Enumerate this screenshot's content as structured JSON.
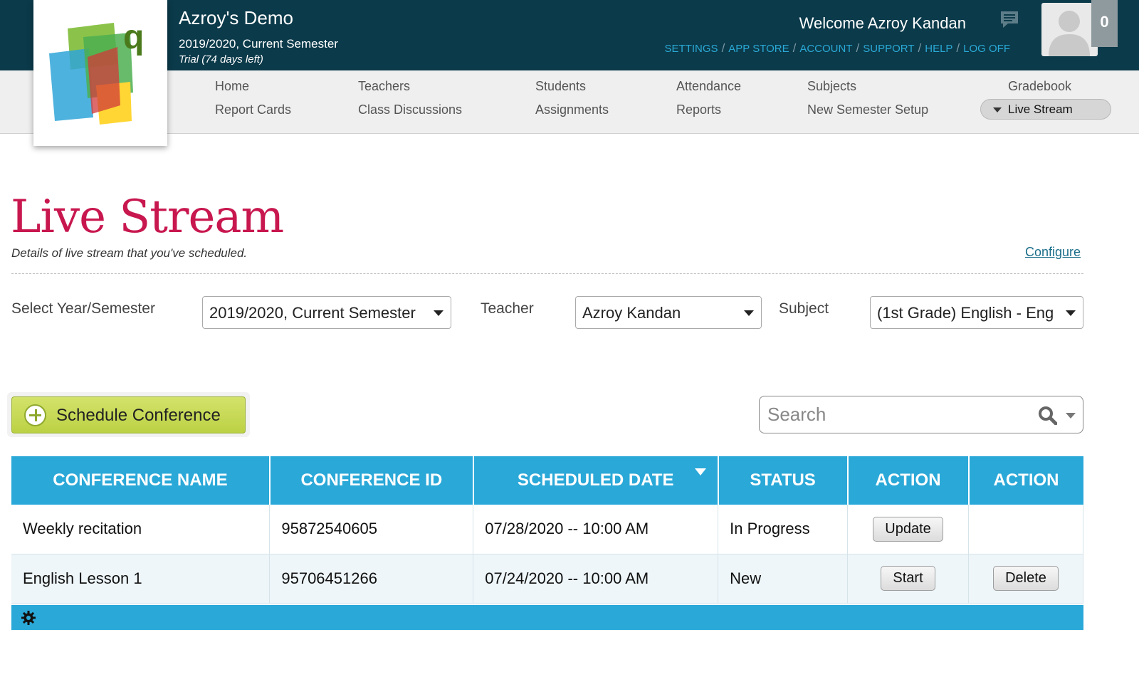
{
  "header": {
    "school_name": "Azroy's Demo",
    "semester": "2019/2020, Current Semester",
    "trial": "Trial (74 days left)",
    "welcome": "Welcome Azroy Kandan",
    "notification_count": "0",
    "links": [
      "SETTINGS",
      "APP STORE",
      "ACCOUNT",
      "SUPPORT",
      "HELP",
      "LOG OFF"
    ]
  },
  "nav": {
    "home": "Home",
    "report_cards": "Report Cards",
    "teachers": "Teachers",
    "class_discussions": "Class Discussions",
    "students": "Students",
    "assignments": "Assignments",
    "attendance": "Attendance",
    "reports": "Reports",
    "subjects": "Subjects",
    "new_semester_setup": "New Semester Setup",
    "gradebook": "Gradebook",
    "live_stream": "Live Stream"
  },
  "page": {
    "title": "Live Stream",
    "description": "Details of live stream that you've scheduled.",
    "configure": "Configure"
  },
  "filters": {
    "year_label": "Select Year/Semester",
    "year_value": "2019/2020, Current Semester",
    "teacher_label": "Teacher",
    "teacher_value": "Azroy Kandan",
    "subject_label": "Subject",
    "subject_value": "(1st Grade) English - Eng"
  },
  "actions": {
    "schedule_conference": "Schedule Conference",
    "search_placeholder": "Search"
  },
  "table": {
    "headers": [
      "CONFERENCE NAME",
      "CONFERENCE ID",
      "SCHEDULED DATE",
      "STATUS",
      "ACTION",
      "ACTION"
    ],
    "rows": [
      {
        "name": "Weekly recitation",
        "id": "95872540605",
        "date": "07/28/2020 -- 10:00 AM",
        "status": "In Progress",
        "action1": "Update",
        "action2": ""
      },
      {
        "name": "English Lesson 1",
        "id": "95706451266",
        "date": "07/24/2020 -- 10:00 AM",
        "status": "New",
        "action1": "Start",
        "action2": "Delete"
      }
    ]
  },
  "colors": {
    "header_bg": "#0b3a4a",
    "title_color": "#c8174f",
    "table_header": "#2aa8d8",
    "schedule_button": "#c6d955",
    "link_color": "#2aa9d6"
  },
  "icons": [
    "message-icon",
    "avatar-placeholder-icon",
    "plus-icon",
    "search-icon",
    "gear-icon",
    "sort-desc-icon"
  ]
}
